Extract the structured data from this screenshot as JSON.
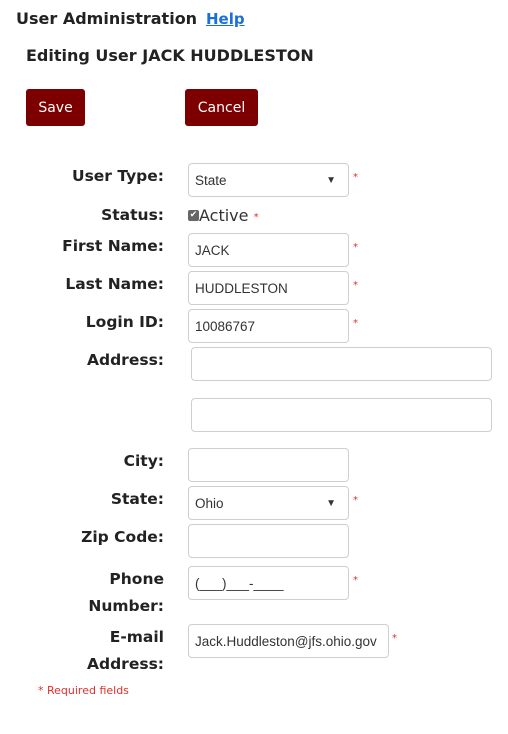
{
  "header": {
    "app_title": "User Administration",
    "help_link": "Help",
    "page_title": "Editing User JACK HUDDLESTON"
  },
  "toolbar": {
    "save_label": "Save",
    "cancel_label": "Cancel"
  },
  "form": {
    "user_type": {
      "label": "User Type:",
      "value": "State",
      "required": "*"
    },
    "status": {
      "label": "Status:",
      "checkbox_label": "Active",
      "checked": true,
      "required": "*"
    },
    "first_name": {
      "label": "First Name:",
      "value": "JACK",
      "required": "*"
    },
    "last_name": {
      "label": "Last Name:",
      "value": "HUDDLESTON",
      "required": "*"
    },
    "login_id": {
      "label": "Login ID:",
      "value": "10086767",
      "required": "*"
    },
    "address": {
      "label": "Address:",
      "line1": "",
      "line2": ""
    },
    "city": {
      "label": "City:",
      "value": ""
    },
    "state": {
      "label": "State:",
      "value": "Ohio",
      "required": "*"
    },
    "zip": {
      "label": "Zip Code:",
      "value": ""
    },
    "phone": {
      "label_line1": "Phone",
      "label_line2": "Number:",
      "value": "(___)___-____",
      "required": "*"
    },
    "email": {
      "label_line1": "E-mail",
      "label_line2": "Address:",
      "value": "Jack.Huddleston@jfs.ohio.gov",
      "required": "*"
    }
  },
  "footer": {
    "required_note": "* Required fields"
  },
  "icons": {
    "dropdown": "▼",
    "check": "✔"
  }
}
